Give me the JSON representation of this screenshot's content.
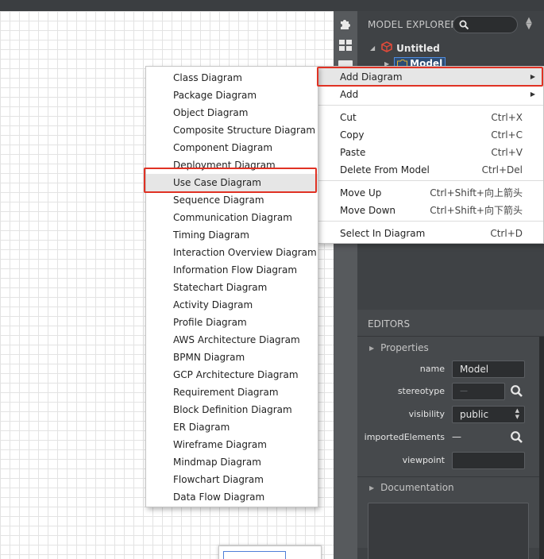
{
  "model_explorer": {
    "header": "MODEL EXPLORER",
    "tree": {
      "root_label": "Untitled",
      "child_label": "Model"
    }
  },
  "context_menu": {
    "items": [
      {
        "label": "Add Diagram",
        "has_submenu": true
      },
      {
        "label": "Add",
        "has_submenu": true
      },
      {
        "label": "Cut",
        "shortcut": "Ctrl+X"
      },
      {
        "label": "Copy",
        "shortcut": "Ctrl+C"
      },
      {
        "label": "Paste",
        "shortcut": "Ctrl+V"
      },
      {
        "label": "Delete From Model",
        "shortcut": "Ctrl+Del"
      },
      {
        "label": "Move Up",
        "shortcut": "Ctrl+Shift+向上箭头"
      },
      {
        "label": "Move Down",
        "shortcut": "Ctrl+Shift+向下箭头"
      },
      {
        "label": "Select In Diagram",
        "shortcut": "Ctrl+D"
      }
    ]
  },
  "diagram_menu": {
    "items": [
      "Class Diagram",
      "Package Diagram",
      "Object Diagram",
      "Composite Structure Diagram",
      "Component Diagram",
      "Deployment Diagram",
      "Use Case Diagram",
      "Sequence Diagram",
      "Communication Diagram",
      "Timing Diagram",
      "Interaction Overview Diagram",
      "Information Flow Diagram",
      "Statechart Diagram",
      "Activity Diagram",
      "Profile Diagram",
      "AWS Architecture Diagram",
      "BPMN Diagram",
      "GCP Architecture Diagram",
      "Requirement Diagram",
      "Block Definition Diagram",
      "ER Diagram",
      "Wireframe Diagram",
      "Mindmap Diagram",
      "Flowchart Diagram",
      "Data Flow Diagram"
    ],
    "highlighted": "Use Case Diagram"
  },
  "editors": {
    "header": "EDITORS",
    "properties_label": "Properties",
    "fields": {
      "name_label": "name",
      "name_value": "Model",
      "stereotype_label": "stereotype",
      "stereotype_placeholder": "—",
      "visibility_label": "visibility",
      "visibility_value": "public",
      "imported_label": "importedElements",
      "imported_value": "—",
      "viewpoint_label": "viewpoint",
      "viewpoint_value": ""
    },
    "documentation_label": "Documentation"
  },
  "colors": {
    "highlight_border": "#e03224",
    "panel_bg": "#3f4245",
    "tree_selection": "#2e4d74"
  }
}
